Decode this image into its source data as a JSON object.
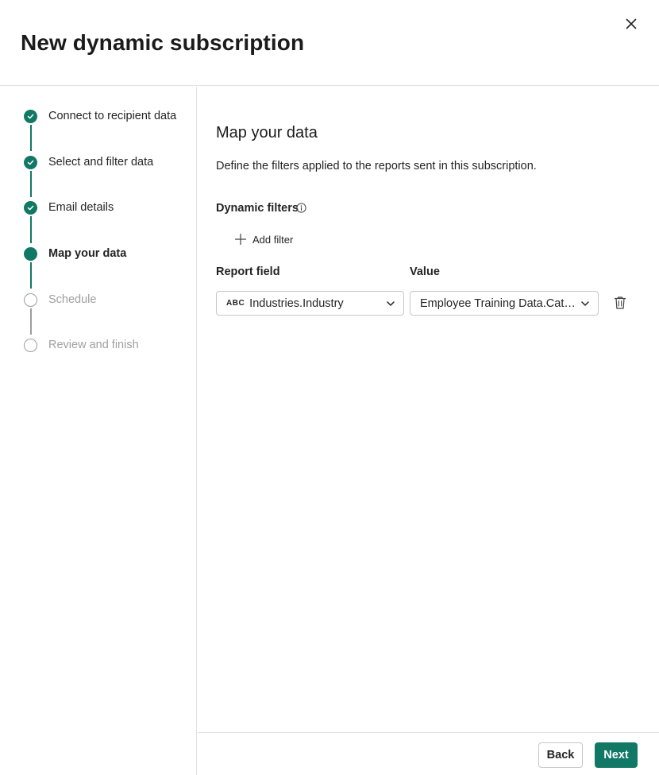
{
  "dialog": {
    "title": "New dynamic subscription",
    "close_icon": "close-icon"
  },
  "steps": [
    {
      "label": "Connect to recipient data",
      "status": "complete"
    },
    {
      "label": "Select and filter data",
      "status": "complete"
    },
    {
      "label": "Email details",
      "status": "complete"
    },
    {
      "label": "Map your data",
      "status": "current"
    },
    {
      "label": "Schedule",
      "status": "pending"
    },
    {
      "label": "Review and finish",
      "status": "pending"
    }
  ],
  "main": {
    "title": "Map your data",
    "description": "Define the filters applied to the reports sent in this subscription.",
    "dynamic_filters_label": "Dynamic filters",
    "add_filter_label": "Add filter",
    "report_field_label": "Report field",
    "value_label": "Value",
    "report_field": {
      "type_badge": "ABC",
      "value": "Industries.Industry"
    },
    "value_field": {
      "value": "Employee Training Data.Category"
    }
  },
  "footer": {
    "back_label": "Back",
    "next_label": "Next"
  },
  "colors": {
    "accent": "#117865",
    "border": "#e1e1e1",
    "pending": "#9e9e9e"
  }
}
